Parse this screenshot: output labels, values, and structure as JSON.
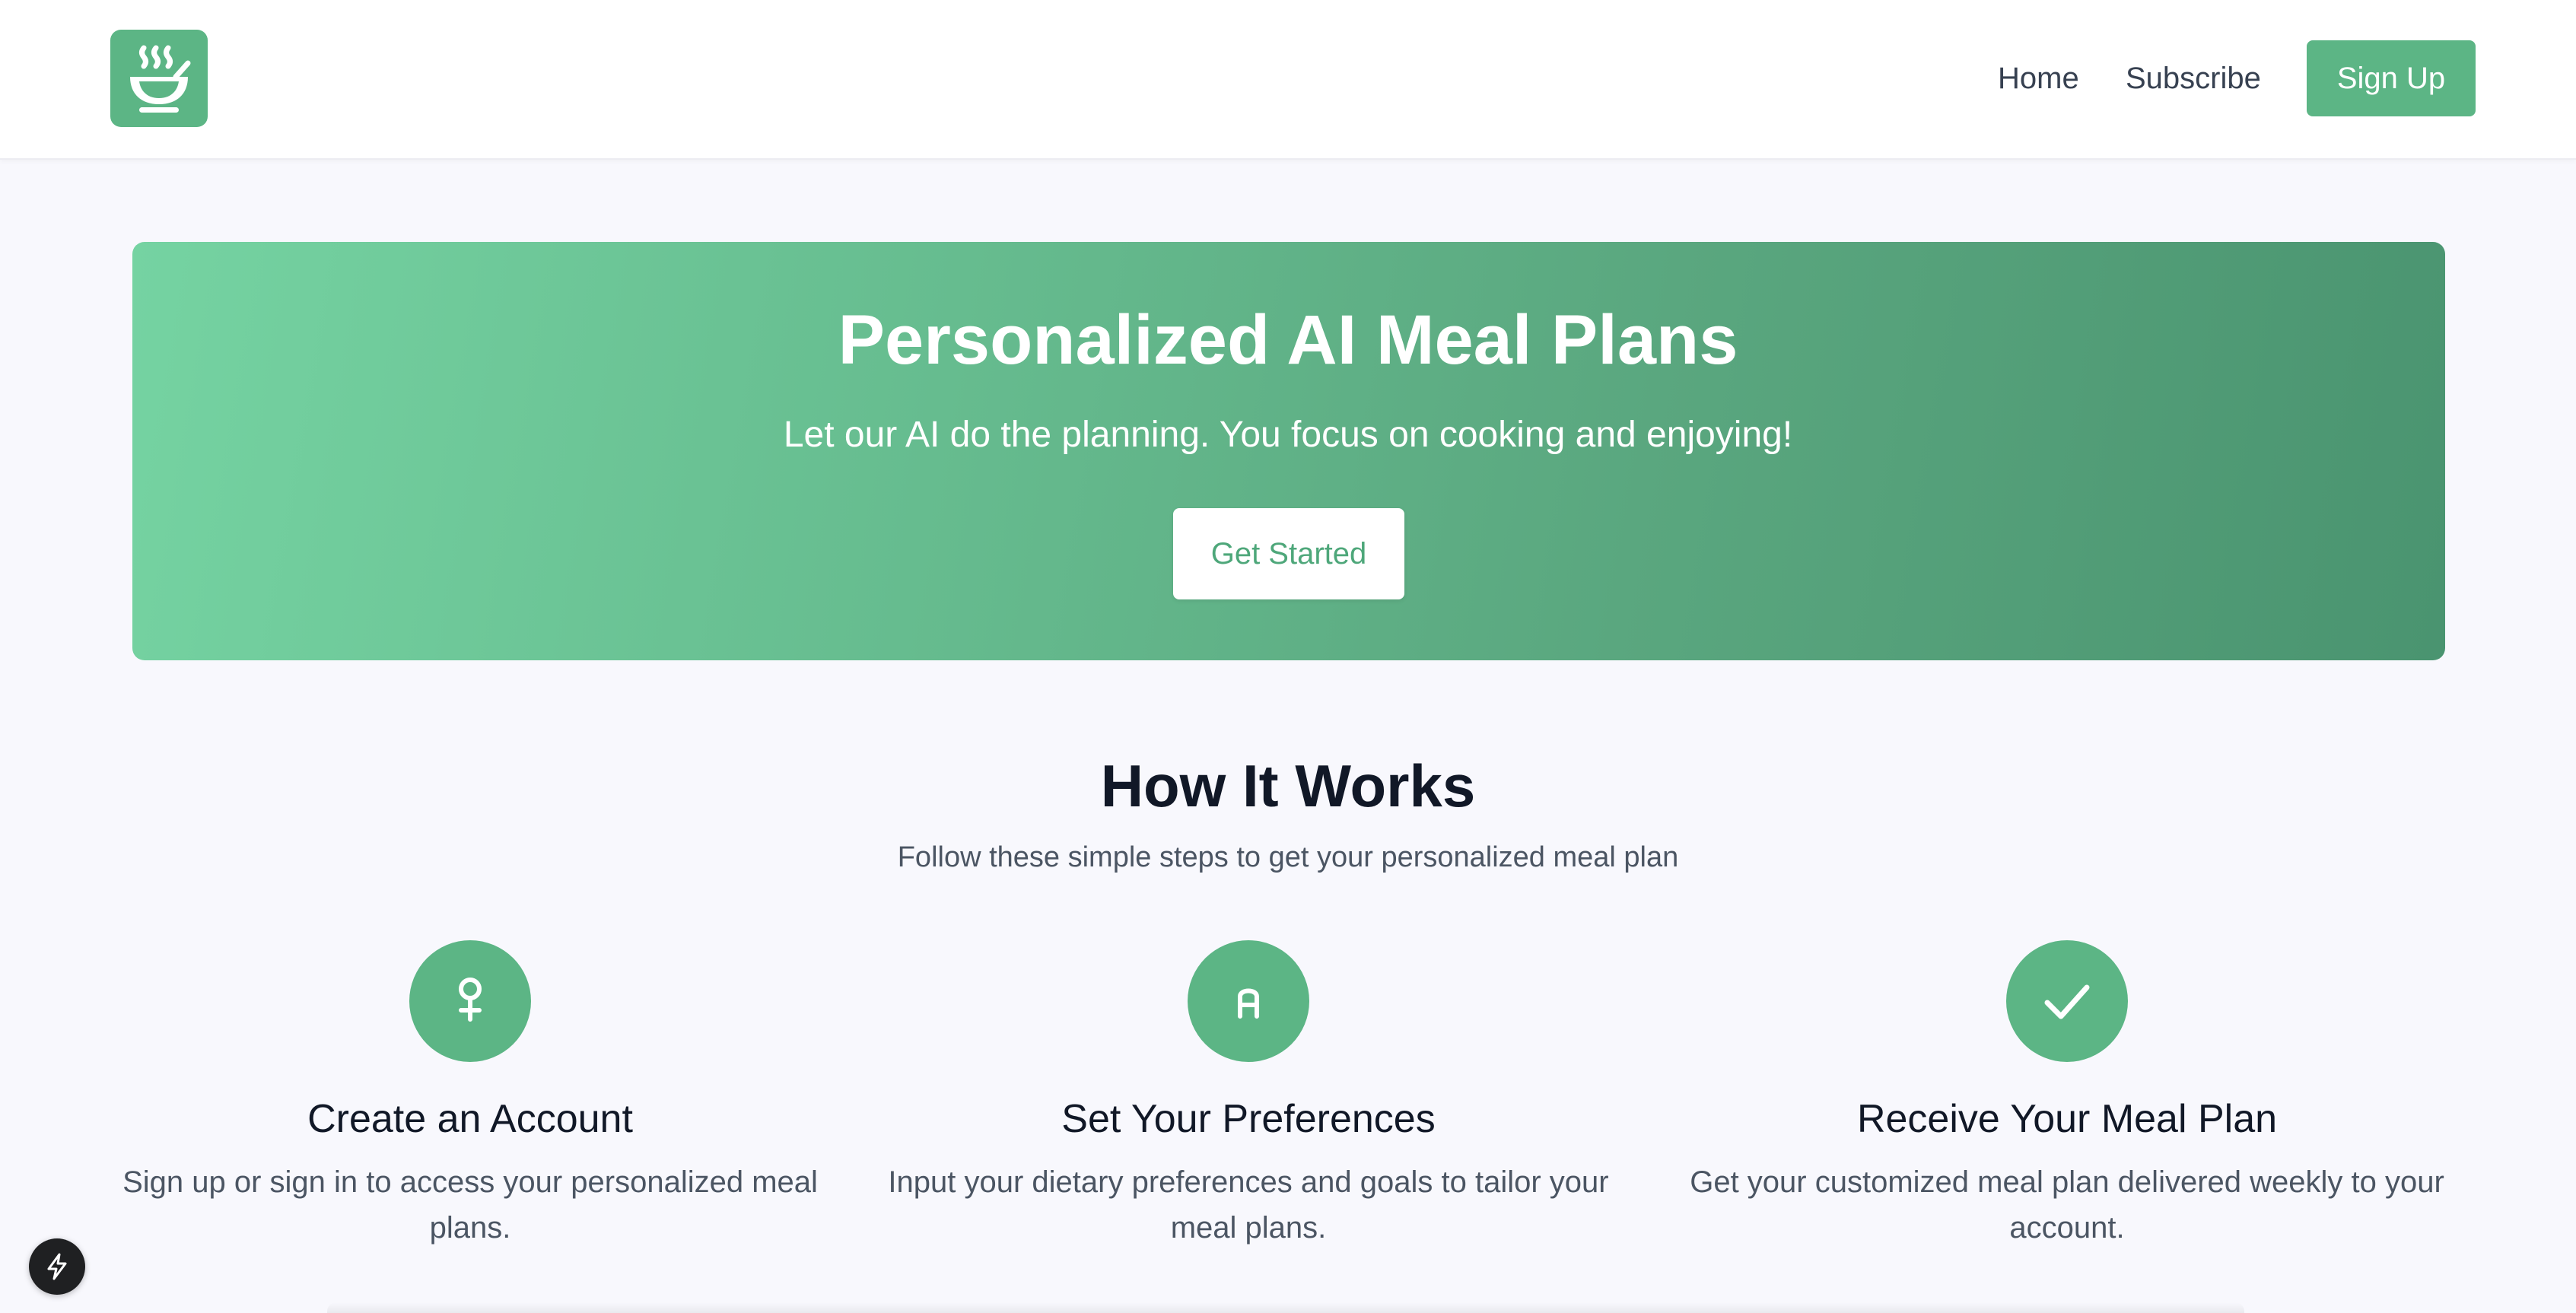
{
  "header": {
    "logo_icon": "steaming-bowl-icon",
    "nav": [
      {
        "label": "Home"
      },
      {
        "label": "Subscribe"
      }
    ],
    "signup_label": "Sign Up"
  },
  "hero": {
    "title": "Personalized AI Meal Plans",
    "subtitle": "Let our AI do the planning. You focus on cooking and enjoying!",
    "cta_label": "Get Started"
  },
  "how_it_works": {
    "title": "How It Works",
    "subtitle": "Follow these simple steps to get your personalized meal plan",
    "steps": [
      {
        "icon": "female-symbol-icon",
        "title": "Create an Account",
        "description": "Sign up or sign in to access your personalized meal plans."
      },
      {
        "icon": "preferences-icon",
        "title": "Set Your Preferences",
        "description": "Input your dietary preferences and goals to tailor your meal plans."
      },
      {
        "icon": "checkmark-icon",
        "title": "Receive Your Meal Plan",
        "description": "Get your customized meal plan delivered weekly to your account."
      }
    ]
  },
  "floating_button": {
    "icon": "lightning-bolt-icon"
  },
  "colors": {
    "brand_green": "#5cb585",
    "hero_gradient_start": "#75d3a2",
    "hero_gradient_end": "#4a9470",
    "page_background": "#f8f8fd"
  }
}
